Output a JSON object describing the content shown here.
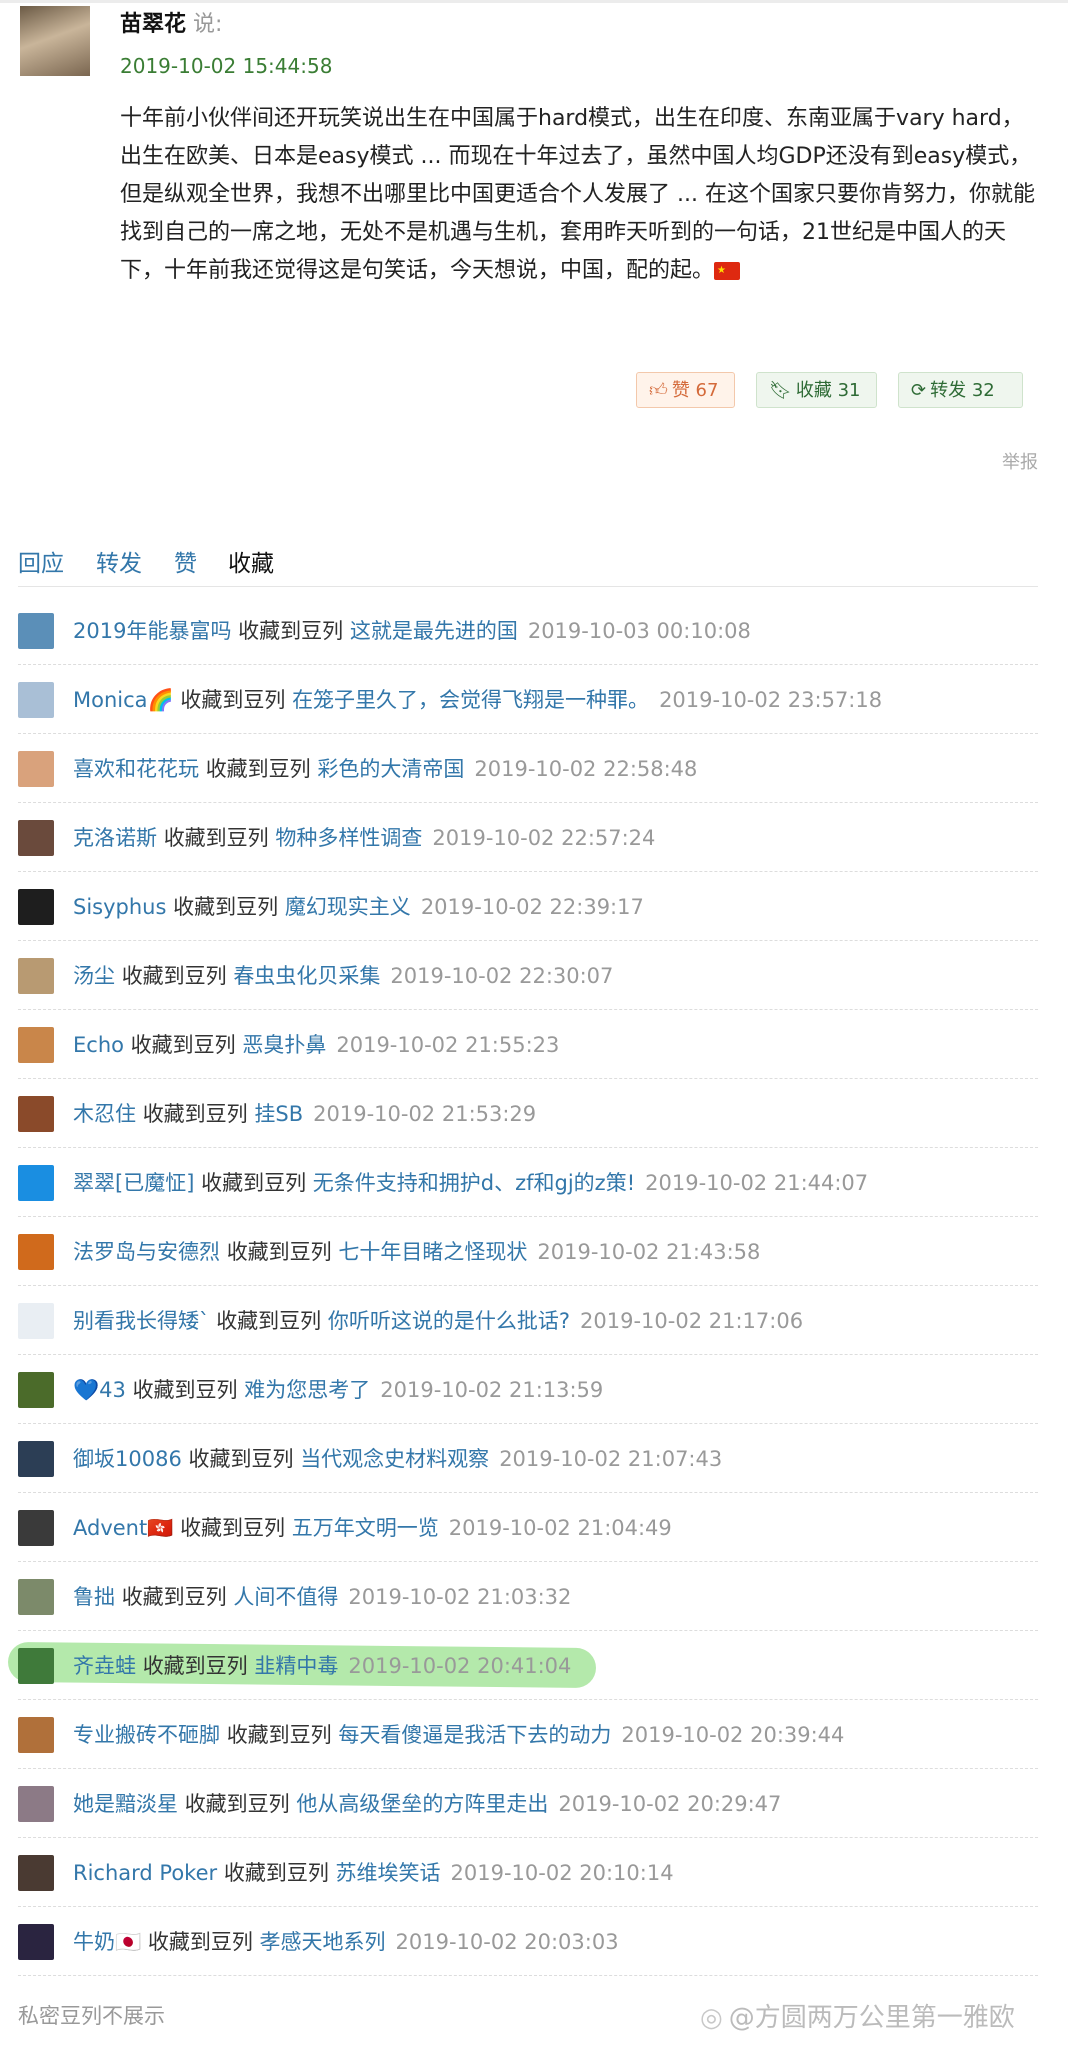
{
  "post": {
    "author": "苗翠花",
    "said": "说:",
    "time": "2019-10-02 15:44:58",
    "body": "十年前小伙伴间还开玩笑说出生在中国属于hard模式，出生在印度、东南亚属于vary hard，出生在欧美、日本是easy模式 ... 而现在十年过去了，虽然中国人均GDP还没有到easy模式，但是纵观全世界，我想不出哪里比中国更适合个人发展了 ... 在这个国家只要你肯努力，你就能找到自己的一席之地，无处不是机遇与生机，套用昨天听到的一句话，21世纪是中国人的天下，十年前我还觉得这是句笑话，今天想说，中国，配的起。",
    "flag": "🇨🇳"
  },
  "actions": {
    "like_label": "赞 67",
    "collect_label": "收藏 31",
    "forward_label": "转发 32",
    "report_label": "举报"
  },
  "icons": {
    "like": "thumb-up-icon",
    "collect": "bookmark-icon",
    "forward": "repost-icon",
    "china_flag": "china-flag-icon",
    "weibo": "weibo-icon"
  },
  "tabs": [
    {
      "label": "回应",
      "active": false
    },
    {
      "label": "转发",
      "active": false
    },
    {
      "label": "赞",
      "active": false
    },
    {
      "label": "收藏",
      "active": true
    }
  ],
  "collect_verb": "收藏到豆列",
  "rows": [
    {
      "user": "2019年能暴富吗",
      "doulist": "这就是最先进的国",
      "time": "2019-10-03 00:10:08",
      "avatar_color": "#5b8fb8"
    },
    {
      "user": "Monica🌈",
      "doulist": "在笼子里久了，会觉得飞翔是一种罪。",
      "time": "2019-10-02 23:57:18",
      "avatar_color": "#a9bfd6"
    },
    {
      "user": "喜欢和花花玩",
      "doulist": "彩色的大清帝国",
      "time": "2019-10-02 22:58:48",
      "avatar_color": "#d9a27c"
    },
    {
      "user": "克洛诺斯",
      "doulist": "物种多样性调查",
      "time": "2019-10-02 22:57:24",
      "avatar_color": "#6a4a3c"
    },
    {
      "user": "Sisyphus",
      "doulist": "魔幻现实主义",
      "time": "2019-10-02 22:39:17",
      "avatar_color": "#1e1e1e"
    },
    {
      "user": "汤尘",
      "doulist": "春虫虫化贝采集",
      "time": "2019-10-02 22:30:07",
      "avatar_color": "#b89a72"
    },
    {
      "user": "Echo",
      "doulist": "恶臭扑鼻",
      "time": "2019-10-02 21:55:23",
      "avatar_color": "#c9864a"
    },
    {
      "user": "木忍住",
      "doulist": "挂SB",
      "time": "2019-10-02 21:53:29",
      "avatar_color": "#8a4a2a"
    },
    {
      "user": "翠翠[已魔怔]",
      "doulist": "无条件支持和拥护d、zf和gj的z策!",
      "time": "2019-10-02 21:44:07",
      "avatar_color": "#1a8ee1"
    },
    {
      "user": "法罗岛与安德烈",
      "doulist": "七十年目睹之怪现状",
      "time": "2019-10-02 21:43:58",
      "avatar_color": "#d06a1c"
    },
    {
      "user": "别看我长得矮`",
      "doulist": "你听听这说的是什么批话?",
      "time": "2019-10-02 21:17:06",
      "avatar_color": "#e9eef3"
    },
    {
      "user": "💙43",
      "doulist": "难为您思考了",
      "time": "2019-10-02 21:13:59",
      "avatar_color": "#4b6b2a"
    },
    {
      "user": "御坂10086",
      "doulist": "当代观念史材料观察",
      "time": "2019-10-02 21:07:43",
      "avatar_color": "#2c3e55"
    },
    {
      "user": "Advent🇭🇰",
      "doulist": "五万年文明一览",
      "time": "2019-10-02 21:04:49",
      "avatar_color": "#3a3a3a"
    },
    {
      "user": "鲁拙",
      "doulist": "人间不值得",
      "time": "2019-10-02 21:03:32",
      "avatar_color": "#7c8a6a"
    },
    {
      "user": "齐垚蛙",
      "doulist": "韭精中毒",
      "time": "2019-10-02 20:41:04",
      "avatar_color": "#3f7a3a",
      "highlighted": true
    },
    {
      "user": "专业搬砖不砸脚",
      "doulist": "每天看傻逼是我活下去的动力",
      "time": "2019-10-02 20:39:44",
      "avatar_color": "#b0703a"
    },
    {
      "user": "她是黯淡星",
      "doulist": "他从高级堡垒的方阵里走出",
      "time": "2019-10-02 20:29:47",
      "avatar_color": "#8c7a86"
    },
    {
      "user": "Richard Poker",
      "doulist": "苏维埃笑话",
      "time": "2019-10-02 20:10:14",
      "avatar_color": "#4a3a32"
    },
    {
      "user": "牛奶🇯🇵",
      "doulist": "孝感天地系列",
      "time": "2019-10-02 20:03:03",
      "avatar_color": "#2a2440"
    }
  ],
  "footer_note": "私密豆列不展示",
  "watermark": "@方圆两万公里第一雅欧"
}
